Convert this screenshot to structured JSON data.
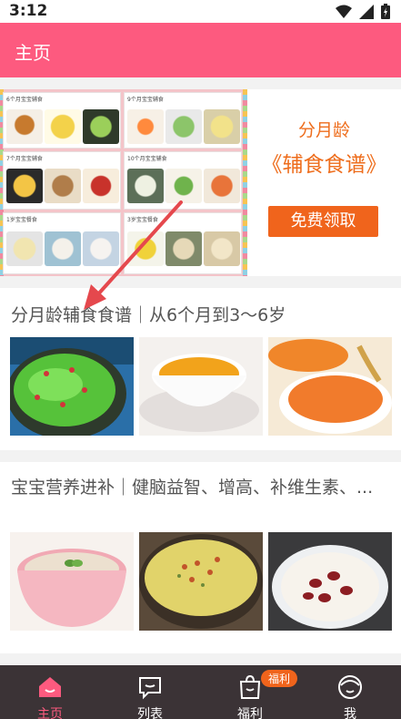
{
  "status_bar": {
    "time": "3:12"
  },
  "app_bar": {
    "title": "主页"
  },
  "banner": {
    "collage_captions": [
      "6个月宝宝辅食",
      "9个月宝宝辅食",
      "7个月宝宝辅食",
      "10个月宝宝辅食",
      "1岁宝宝餐食",
      "3岁宝宝餐食"
    ],
    "promo_line1": "分月龄",
    "promo_line2": "《辅食食谱》",
    "promo_button": "免费领取"
  },
  "cards": [
    {
      "title": "分月龄辅食食谱｜从6个月到3～6岁"
    },
    {
      "title": "宝宝营养进补｜健脑益智、增高、补维生素、..."
    }
  ],
  "bottom_nav": {
    "items": [
      {
        "label": "主页",
        "icon": "home-icon",
        "active": true
      },
      {
        "label": "列表",
        "icon": "chat-list-icon",
        "active": false
      },
      {
        "label": "福利",
        "icon": "shopping-bag-icon",
        "active": false,
        "badge": "福利"
      },
      {
        "label": "我",
        "icon": "profile-icon",
        "active": false
      }
    ]
  },
  "colors": {
    "brand_pink": "#fd5a7f",
    "promo_orange": "#f0641c",
    "nav_bg": "#3b3336"
  }
}
